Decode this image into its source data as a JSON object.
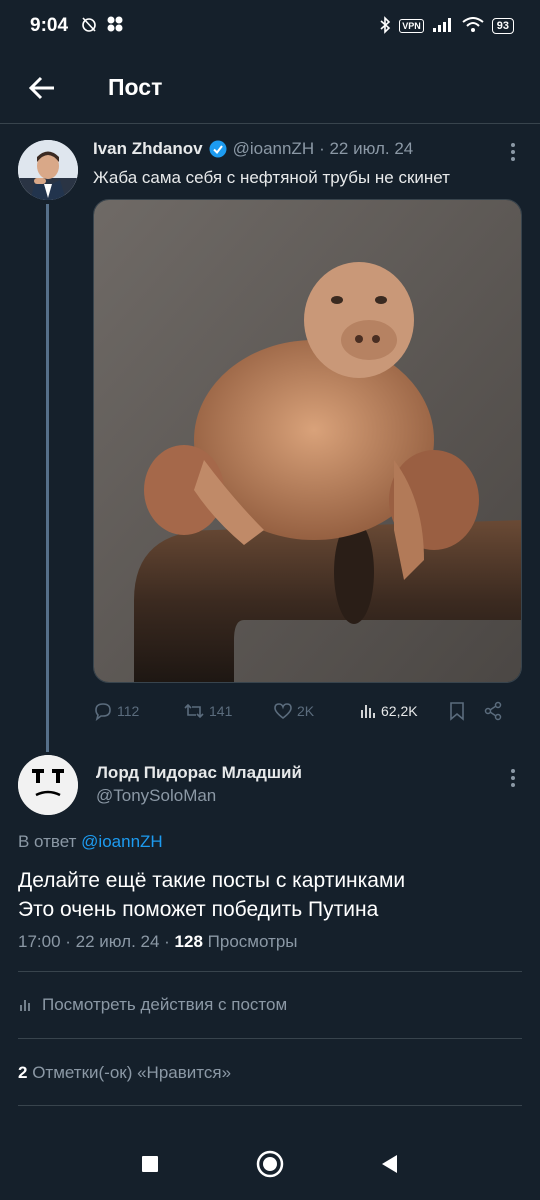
{
  "status": {
    "time": "9:04",
    "vpn": "VPN",
    "battery": "93"
  },
  "header": {
    "title": "Пост"
  },
  "parent_tweet": {
    "name": "Ivan Zhdanov",
    "handle": "@ioannZH",
    "date": "· 22 июл. 24",
    "text": "Жаба сама себя с нефтяной трубы не скинет",
    "replies": "112",
    "retweets": "141",
    "likes": "2K",
    "views": "62,2K"
  },
  "main_tweet": {
    "name": "Лорд Пидорас Младший",
    "handle": "@TonySoloMan",
    "reply_prefix": "В ответ ",
    "reply_mention": "@ioannZH",
    "text_line1": "Делайте ещё такие посты с картинками",
    "text_line2": "Это очень поможет победить Путина",
    "time_date": "17:00 · 22 июл. 24 · ",
    "views_count": "128",
    "views_label": " Просмотры",
    "activity_label": "Посмотреть действия с постом",
    "likes_count": "2",
    "likes_label": " Отметки(-ок) «Нравится»"
  },
  "colors": {
    "background": "#15202b",
    "accent": "#1d9bf0",
    "secondary_text": "#8b98a5",
    "divider": "#38444d"
  }
}
